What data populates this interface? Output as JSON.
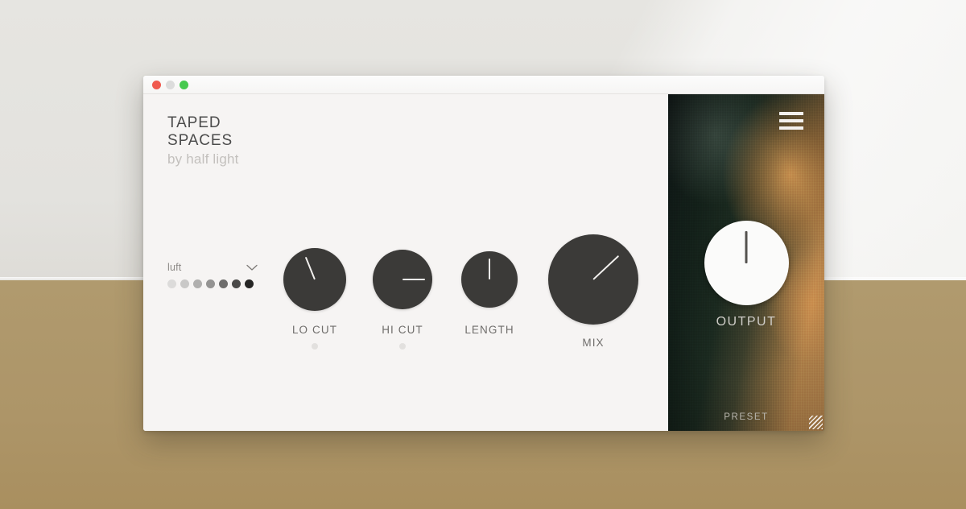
{
  "desktop": {
    "upper_color": "#e4e3df",
    "lower_color": "#ad9568"
  },
  "window": {
    "titlebar": {
      "close_label": "close",
      "minimize_label": "minimize",
      "zoom_label": "zoom",
      "colors": {
        "close": "#f05a4f",
        "minimize": "#dcdcdc",
        "zoom": "#46c94f"
      }
    },
    "brand": {
      "line1": "TAPED",
      "line2": "SPACES",
      "byline": "by half light"
    },
    "preset_selector": {
      "name": "luft",
      "chevron_icon": "chevron-down-icon",
      "dots": [
        {
          "color": "#dcdbda"
        },
        {
          "color": "#c9c8c7"
        },
        {
          "color": "#b0afae"
        },
        {
          "color": "#949392"
        },
        {
          "color": "#6e6d6c"
        },
        {
          "color": "#4a4948"
        },
        {
          "color": "#262524"
        }
      ]
    },
    "knobs": [
      {
        "id": "lo-cut",
        "label": "LO CUT",
        "size": 78,
        "angle": -22,
        "pointer_length": 30,
        "has_indicator_dot": true,
        "face": "#3b3a38",
        "pointer": "#f2f0ee"
      },
      {
        "id": "hi-cut",
        "label": "HI CUT",
        "size": 74,
        "angle": 90,
        "pointer_length": 28,
        "has_indicator_dot": true,
        "face": "#3b3a38",
        "pointer": "#f2f0ee"
      },
      {
        "id": "length",
        "label": "LENGTH",
        "size": 70,
        "angle": 0,
        "pointer_length": 26,
        "has_indicator_dot": false,
        "face": "#3b3a38",
        "pointer": "#f2f0ee"
      },
      {
        "id": "mix",
        "label": "MIX",
        "size": 112,
        "angle": 47,
        "pointer_length": 43,
        "has_indicator_dot": false,
        "face": "#3b3a38",
        "pointer": "#f2f0ee"
      }
    ],
    "right_panel": {
      "menu_icon": "hamburger-menu-icon",
      "output": {
        "label": "OUTPUT",
        "angle": 0,
        "pointer_length": 40,
        "face": "#fbfbfa",
        "pointer": "#54524f"
      },
      "footer_label": "PRESET"
    },
    "resize_grip_icon": "resize-grip-icon"
  }
}
